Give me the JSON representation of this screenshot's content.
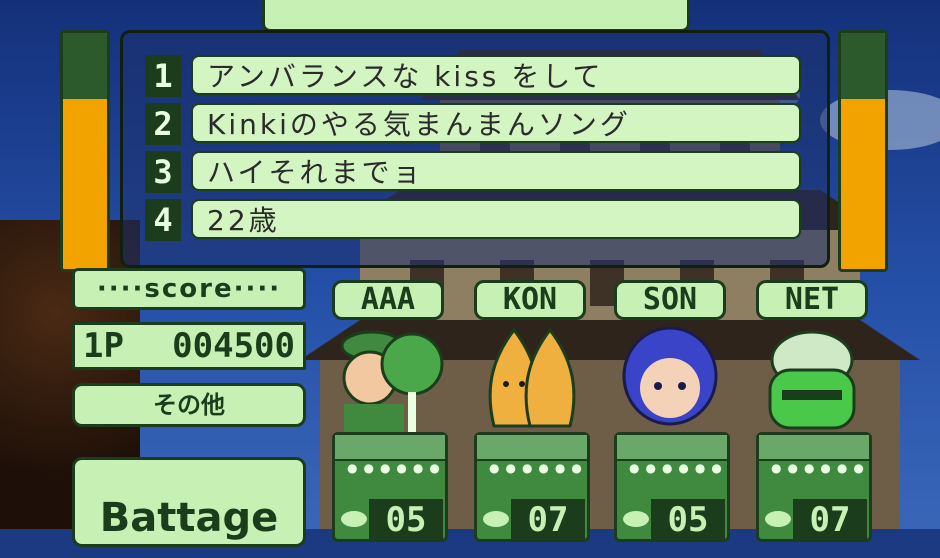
{
  "title": "",
  "answers": [
    {
      "num": "1",
      "text": "アンバランスな kiss をして"
    },
    {
      "num": "2",
      "text": "Kinkiのやる気まんまんソング"
    },
    {
      "num": "3",
      "text": "ハイそれまでョ"
    },
    {
      "num": "4",
      "text": "22歳"
    }
  ],
  "score": {
    "title": "····score····",
    "player_label": "1P",
    "value": "004500"
  },
  "genre": "その他",
  "mode": "Battage",
  "time_meter_level": 0.72,
  "players": [
    {
      "name": "AAA",
      "count": "05"
    },
    {
      "name": "KON",
      "count": "07"
    },
    {
      "name": "SON",
      "count": "05"
    },
    {
      "name": "NET",
      "count": "07"
    }
  ],
  "colors": {
    "panel_green": "#c6f0b4",
    "border_green": "#1b3d1b",
    "meter_orange": "#f2a300"
  }
}
